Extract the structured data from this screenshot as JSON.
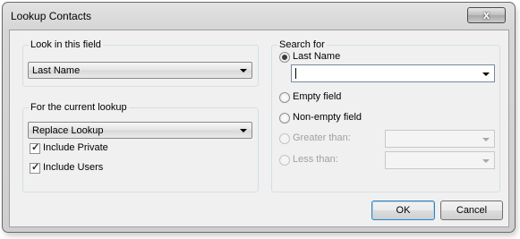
{
  "window": {
    "title": "Lookup Contacts",
    "close_label": "x"
  },
  "look_in": {
    "label": "Look in this field",
    "value": "Last Name"
  },
  "current_lookup": {
    "label": "For the current lookup",
    "value": "Replace Lookup",
    "checkboxes": [
      {
        "label": "Include Private",
        "checked": true
      },
      {
        "label": "Include Users",
        "checked": true
      }
    ]
  },
  "search_for": {
    "label": "Search for",
    "options": [
      {
        "label": "Last Name",
        "selected": true,
        "enabled": true
      },
      {
        "label": "Empty field",
        "selected": false,
        "enabled": true
      },
      {
        "label": "Non-empty field",
        "selected": false,
        "enabled": true
      },
      {
        "label": "Greater than:",
        "selected": false,
        "enabled": false
      },
      {
        "label": "Less than:",
        "selected": false,
        "enabled": false
      }
    ],
    "last_name_value": ""
  },
  "buttons": {
    "ok": "OK",
    "cancel": "Cancel"
  },
  "check_mark": "✓"
}
